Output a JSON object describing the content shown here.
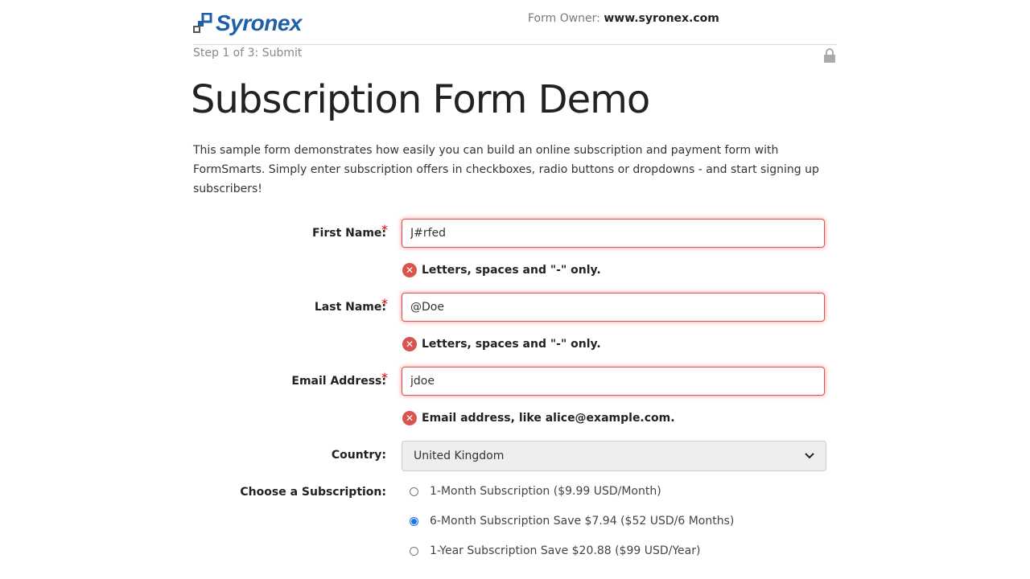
{
  "header": {
    "logo_text": "Syronex",
    "owner_label": "Form Owner: ",
    "owner_value": "www.syronex.com"
  },
  "step": {
    "text": "Step 1 of 3: Submit"
  },
  "title": "Subscription Form Demo",
  "intro": "This sample form demonstrates how easily you can build an online subscription and payment form with FormSmarts. Simply enter subscription offers in checkboxes, radio buttons or dropdowns - and start signing up subscribers!",
  "fields": {
    "first_name": {
      "label": "First Name:",
      "value": "J#rfed",
      "error": "Letters, spaces and \"-\" only."
    },
    "last_name": {
      "label": "Last Name:",
      "value": "@Doe",
      "error": "Letters, spaces and \"-\" only."
    },
    "email": {
      "label": "Email Address:",
      "value": "jdoe",
      "error": "Email address, like alice@example.com."
    },
    "required_mark": "*",
    "country": {
      "label": "Country:",
      "value": "United Kingdom"
    },
    "subscription": {
      "label": "Choose a Subscription:",
      "options": [
        {
          "label": "1-Month Subscription ($9.99 USD/Month)",
          "selected": false
        },
        {
          "label": "6-Month Subscription Save $7.94 ($52 USD/6 Months)",
          "selected": true
        },
        {
          "label": "1-Year Subscription Save $20.88 ($99 USD/Year)",
          "selected": false
        }
      ]
    }
  },
  "icons": {
    "logo": "syronex-logo-icon",
    "lock": "lock-icon",
    "error": "error-icon",
    "dropdown": "chevron-down-icon"
  },
  "colors": {
    "brand": "#1f5fa8",
    "error": "#d9534f",
    "radio_selected": "#1a73e8"
  }
}
